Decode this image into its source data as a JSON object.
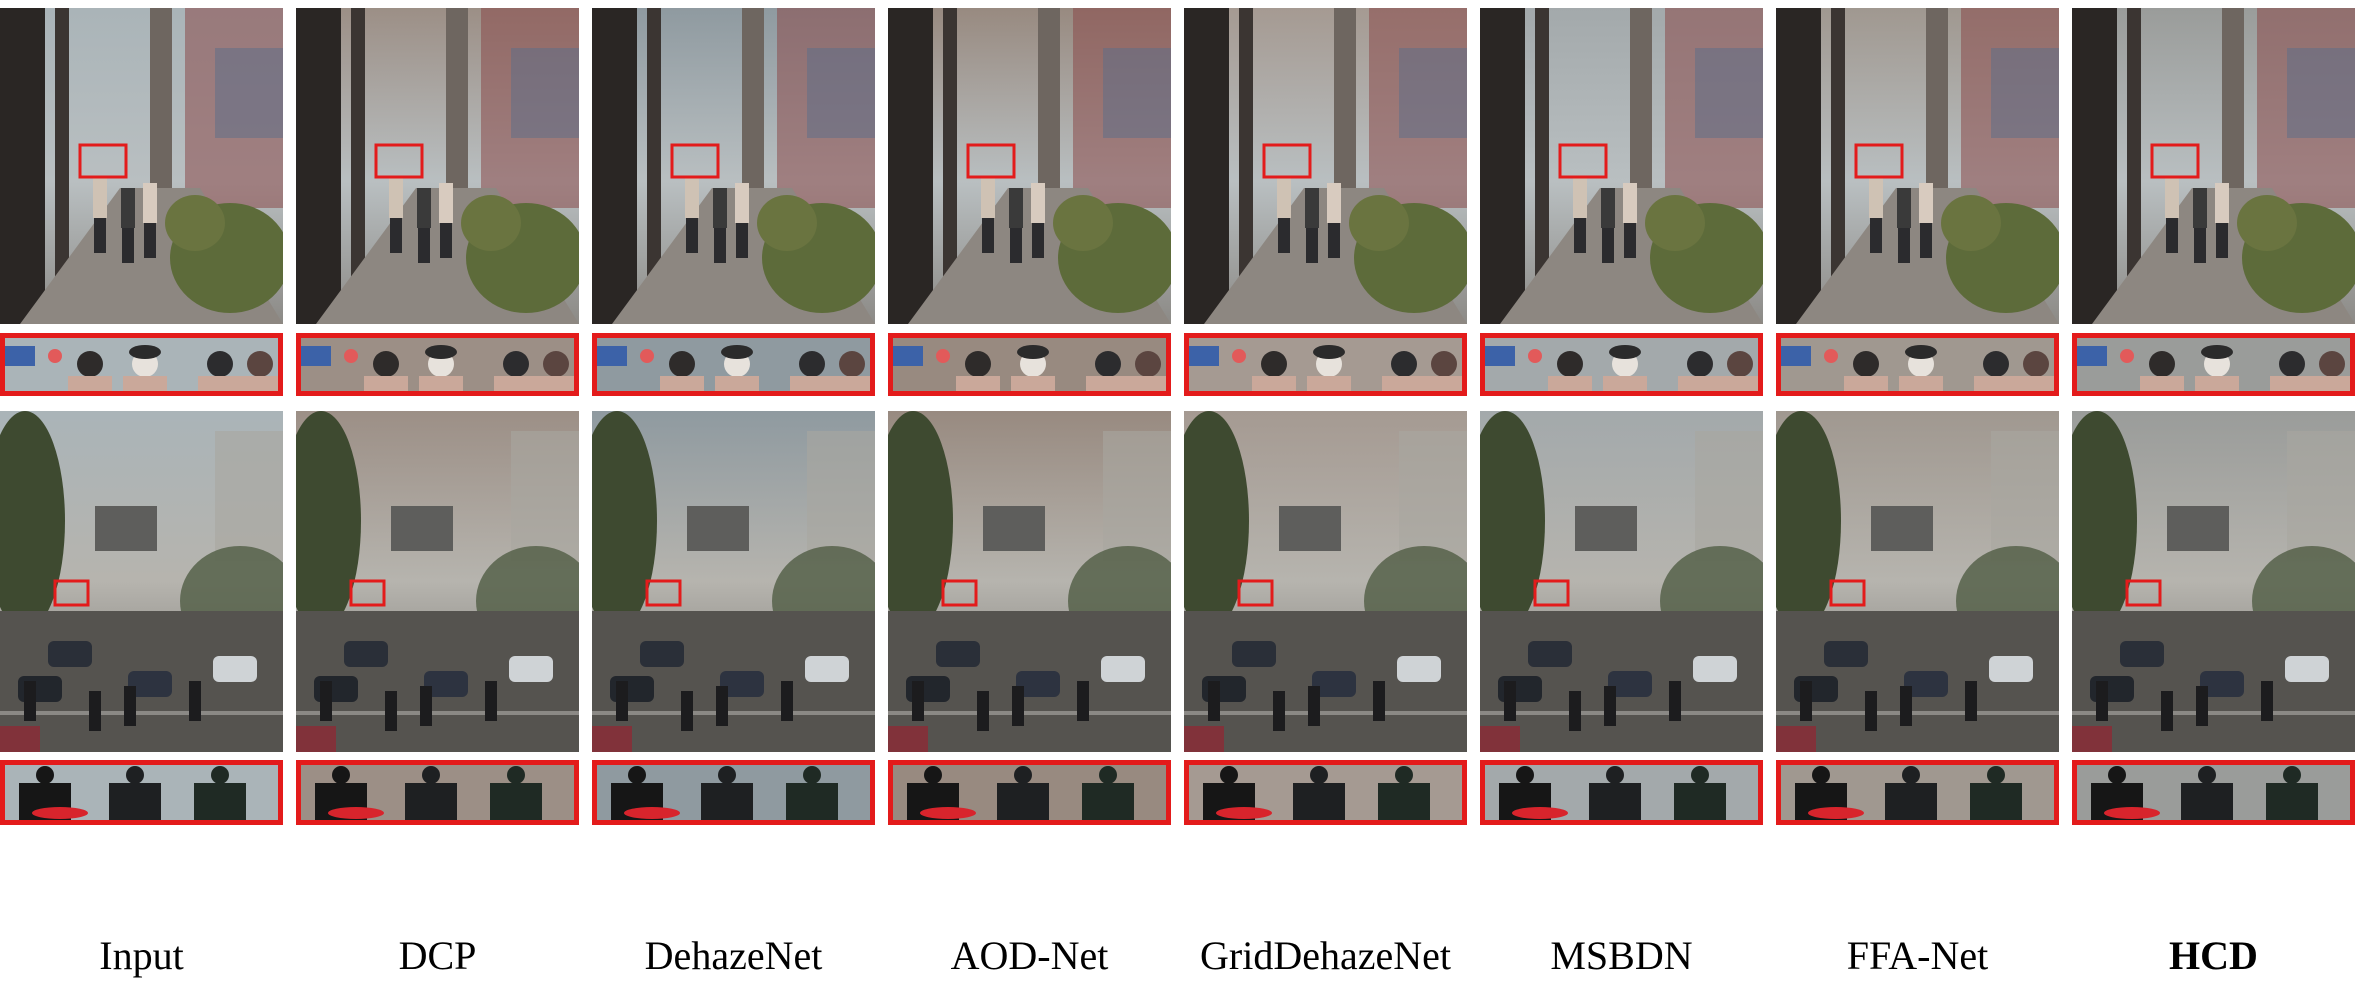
{
  "methods": [
    {
      "label": "Input",
      "bold": false,
      "tone": "#aab4b8"
    },
    {
      "label": "DCP",
      "bold": false,
      "tone": "#9c8f86"
    },
    {
      "label": "DehazeNet",
      "bold": false,
      "tone": "#8f9aa0"
    },
    {
      "label": "AOD-Net",
      "bold": false,
      "tone": "#988a80"
    },
    {
      "label": "GridDehazeNet",
      "bold": false,
      "tone": "#a59a92"
    },
    {
      "label": "MSBDN",
      "bold": false,
      "tone": "#a3a9ab"
    },
    {
      "label": "FFA-Net",
      "bold": false,
      "tone": "#a09890"
    },
    {
      "label": "HCD",
      "bold": true,
      "tone": "#9a9c9a"
    }
  ],
  "colors": {
    "zoom_box": "#e31b1b",
    "background": "#ffffff"
  }
}
